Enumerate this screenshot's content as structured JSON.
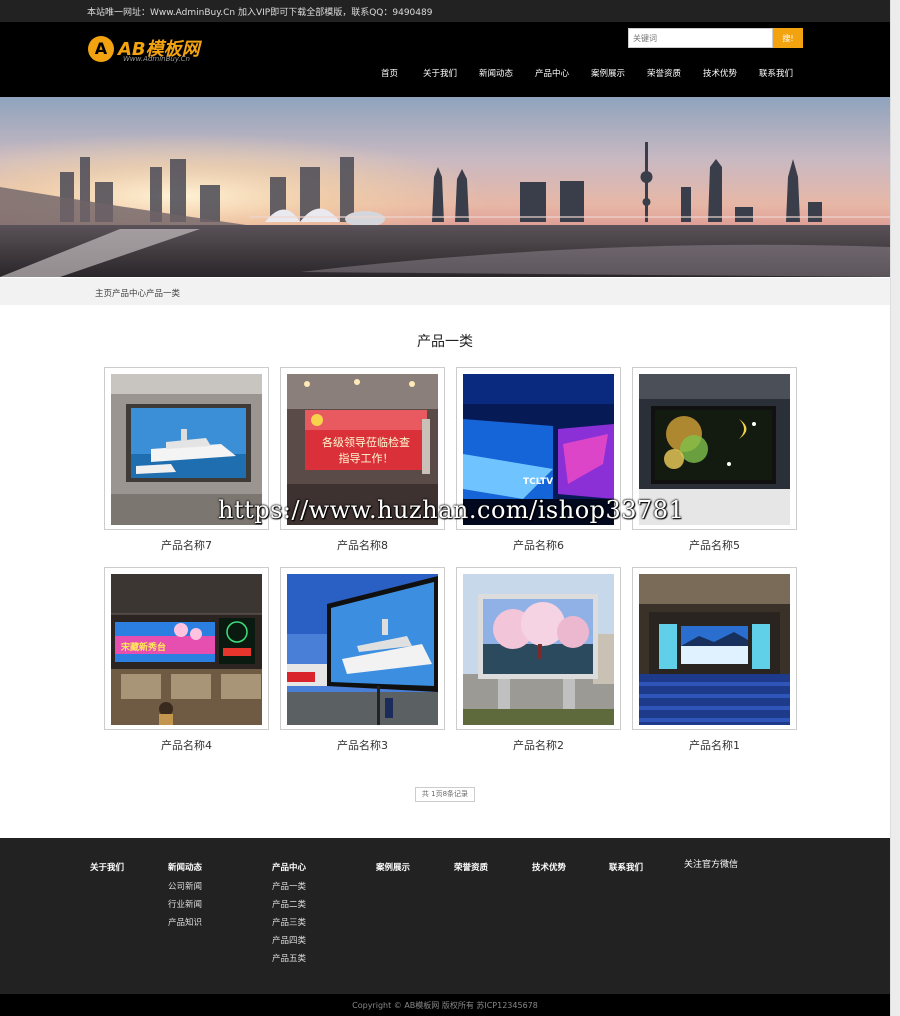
{
  "topbar": {
    "notice": "本站唯一网址：Www.AdminBuy.Cn 加入VIP即可下载全部模版，联系QQ：9490489"
  },
  "header": {
    "logo_badge": "A",
    "logo_name": "AB模板网",
    "logo_url": "Www.AdminBuy.Cn",
    "search_placeholder": "关键词",
    "search_button": "搜!"
  },
  "nav": [
    "首页",
    "关于我们",
    "新闻动态",
    "产品中心",
    "案例展示",
    "荣誉资质",
    "技术优势",
    "联系我们"
  ],
  "breadcrumb": "主页产品中心产品一类",
  "section_title": "产品一类",
  "products": [
    {
      "name": "产品名称7",
      "scene": "boat-screen-room"
    },
    {
      "name": "产品名称8",
      "scene": "meeting-screen"
    },
    {
      "name": "产品名称6",
      "scene": "blue-hall"
    },
    {
      "name": "产品名称5",
      "scene": "night-screen"
    },
    {
      "name": "产品名称4",
      "scene": "station-screen"
    },
    {
      "name": "产品名称3",
      "scene": "outdoor-boat"
    },
    {
      "name": "产品名称2",
      "scene": "blossom-billboard"
    },
    {
      "name": "产品名称1",
      "scene": "auditorium"
    }
  ],
  "product_screen_text": {
    "line1": "各级领导莅临检查",
    "line2": "指导工作！",
    "station": "宋藏新秀台",
    "hall": "TCLTV"
  },
  "watermark": "https://www.huzhan.com/ishop33781",
  "pager": "共 1页8条记录",
  "footer": {
    "columns": [
      {
        "head": "关于我们",
        "links": []
      },
      {
        "head": "新闻动态",
        "links": [
          "公司新闻",
          "行业新闻",
          "产品知识"
        ]
      },
      {
        "head": "产品中心",
        "links": [
          "产品一类",
          "产品二类",
          "产品三类",
          "产品四类",
          "产品五类"
        ]
      },
      {
        "head": "案例展示",
        "links": []
      },
      {
        "head": "荣誉资质",
        "links": []
      },
      {
        "head": "技术优势",
        "links": []
      },
      {
        "head": "联系我们",
        "links": []
      }
    ],
    "wechat": "关注官方微信"
  },
  "copyright": "Copyright © AB模板网 版权所有    苏ICP12345678",
  "colors": {
    "accent": "#f2a30f",
    "header_bg": "#000000",
    "footer_bg": "#222222"
  }
}
